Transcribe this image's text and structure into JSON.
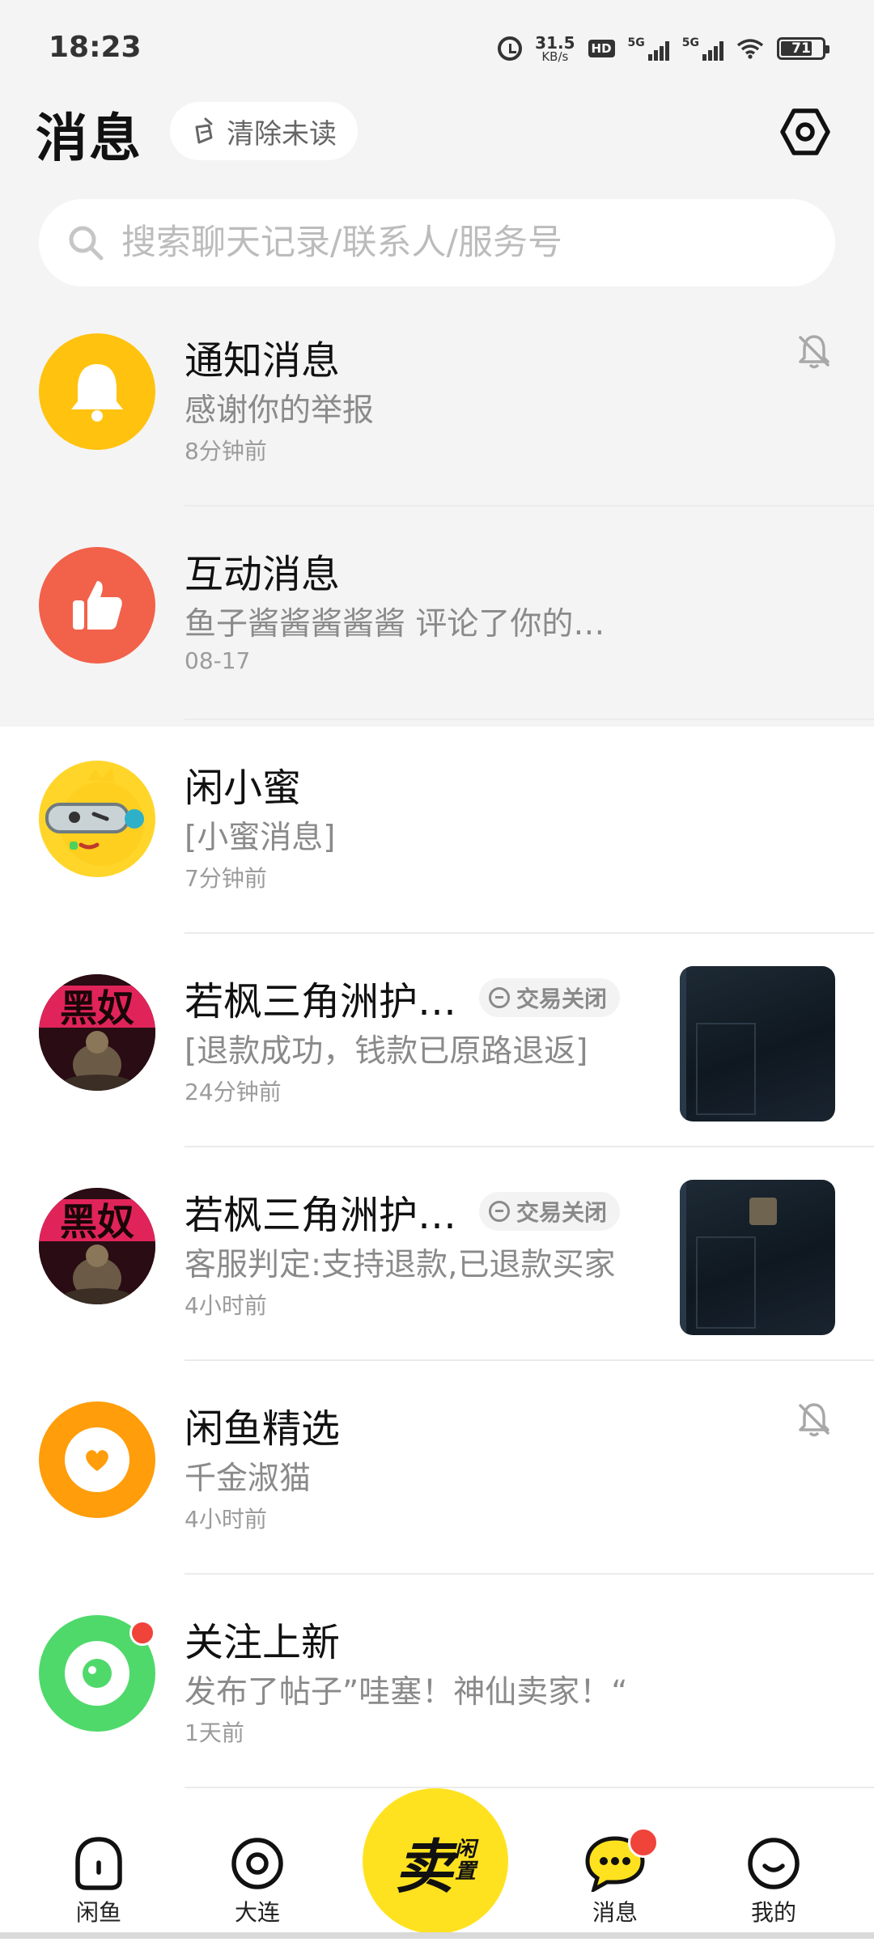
{
  "status_bar": {
    "time": "18:23",
    "net_speed_value": "31.5",
    "net_speed_unit": "KB/s",
    "hd_badge": "HD",
    "sim1_label": "5G",
    "sim2_label": "5G",
    "battery_level": "71"
  },
  "header": {
    "title": "消息",
    "clear_unread_label": "清除未读",
    "settings_icon": "settings-hexagon-icon"
  },
  "search": {
    "placeholder": "搜索聊天记录/联系人/服务号"
  },
  "conversations": [
    {
      "name": "通知消息",
      "message": "感谢你的举报",
      "time": "8分钟前",
      "muted": true,
      "avatar_color": "#ffc20e",
      "avatar_icon": "bell-icon"
    },
    {
      "name": "互动消息",
      "message": "鱼子酱酱酱酱酱 评论了你的…",
      "time": "08-17",
      "muted": false,
      "avatar_color": "#f2614a",
      "avatar_icon": "thumbs-up-icon"
    },
    {
      "name": "闲小蜜",
      "message": "[小蜜消息]",
      "time": "7分钟前",
      "muted": false,
      "avatar_color": "#ffd52a",
      "avatar_icon": "mascot-icon"
    },
    {
      "name": "若枫三角洲护…",
      "message": "[退款成功，钱款已原路退返]",
      "time": "24分钟前",
      "tag": "交易关闭",
      "avatar_text": "黑奴",
      "has_thumbnail": true
    },
    {
      "name": "若枫三角洲护…",
      "message": "客服判定:支持退款,已退款买家",
      "time": "4小时前",
      "tag": "交易关闭",
      "avatar_text": "黑奴",
      "has_thumbnail": true
    },
    {
      "name": "闲鱼精选",
      "message": "千金淑猫",
      "time": "4小时前",
      "muted": true,
      "avatar_color": "#ff9d0a",
      "avatar_icon": "heart-icon"
    },
    {
      "name": "关注上新",
      "message": "发布了帖子”哇塞！神仙卖家！“",
      "time": "1天前",
      "muted": false,
      "unread": true,
      "avatar_color": "#4fd96b",
      "avatar_icon": "eye-icon"
    }
  ],
  "tabbar": {
    "tabs": [
      {
        "label": "闲鱼",
        "icon": "home-icon"
      },
      {
        "label": "大连",
        "icon": "location-icon"
      },
      {
        "label": "消息",
        "icon": "chat-icon",
        "badge": true
      },
      {
        "label": "我的",
        "icon": "smiley-icon"
      }
    ],
    "sell_main": "卖",
    "sell_sub_1": "闲",
    "sell_sub_2": "置"
  },
  "colors": {
    "accent_yellow": "#ffe21f",
    "badge_red": "#f0433a",
    "header_background": "#f4f4f4"
  }
}
